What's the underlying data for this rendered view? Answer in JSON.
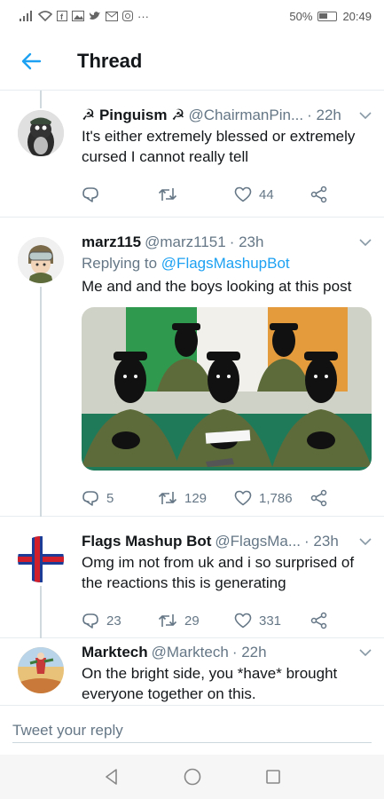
{
  "status": {
    "battery": "50%",
    "time": "20:49",
    "dots": "···"
  },
  "header": {
    "title": "Thread"
  },
  "tweets": [
    {
      "name": "☭ Pinguism ☭",
      "handle": "@ChairmanPin...",
      "time": "· 22h",
      "text": "It's either extremely blessed or extremely cursed I cannot really tell",
      "replies": "",
      "retweets": "",
      "likes": "44"
    },
    {
      "name": "marz115",
      "handle": "@marz1151",
      "time": "· 23h",
      "replying_label": "Replying to",
      "replying_to": "@FlagsMashupBot",
      "text": "Me and and the boys looking at this post",
      "replies": "5",
      "retweets": "129",
      "likes": "1,786"
    },
    {
      "name": "Flags Mashup Bot",
      "handle": "@FlagsMa...",
      "time": "· 23h",
      "text": "Omg im not from uk and i so surprised of the reactions this is generating",
      "replies": "23",
      "retweets": "29",
      "likes": "331"
    },
    {
      "name": "Marktech",
      "handle": "@Marktech",
      "time": "· 22h",
      "text": "On the bright side, you *have* brought everyone together on this."
    }
  ],
  "composer": {
    "placeholder": "Tweet your reply"
  },
  "colors": {
    "accent": "#1da1f2",
    "text": "#14171a",
    "secondary": "#657786"
  }
}
